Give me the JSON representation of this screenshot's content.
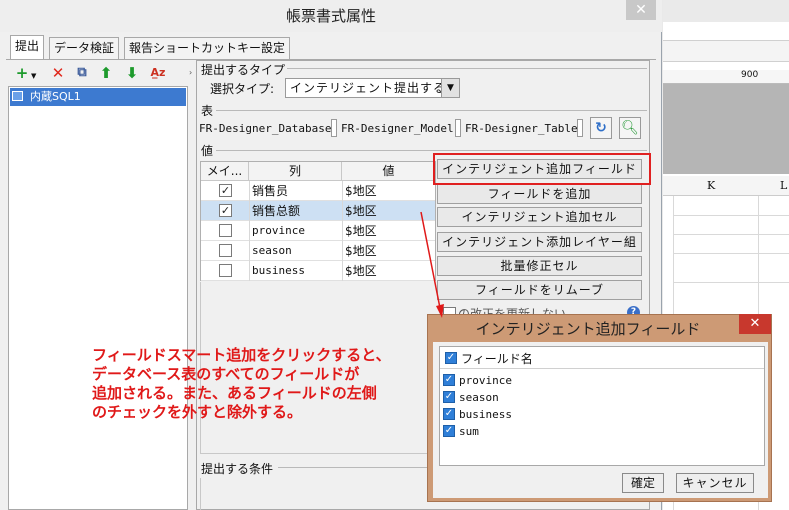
{
  "dialog": {
    "title": "帳票書式属性",
    "close_label": "✕",
    "tabs": [
      "提出",
      "データ検証",
      "報告ショートカットキー設定"
    ]
  },
  "left_panel": {
    "toolbar": [
      "+",
      "✕",
      "⧉",
      "⬆",
      "⬇",
      "A̲z"
    ],
    "datasources": [
      "内蔵SQL1"
    ]
  },
  "submit_type": {
    "section_label": "提出するタイプ",
    "select_label": "選択タイプ:",
    "select_value": "インテリジェント提出する"
  },
  "table_section": {
    "label": "表",
    "database_label": "FR-Designer_Database:",
    "model_label": "FR-Designer_Model:",
    "table_label": "FR-Designer_Table:"
  },
  "values_section": {
    "label": "値",
    "columns": [
      "メイ...",
      "列",
      "値"
    ],
    "rows": [
      {
        "checked": true,
        "column": "销售员",
        "value": "$地区"
      },
      {
        "checked": true,
        "column": "销售总额",
        "value": "$地区"
      },
      {
        "checked": false,
        "column": "province",
        "value": "$地区"
      },
      {
        "checked": false,
        "column": "season",
        "value": "$地区"
      },
      {
        "checked": false,
        "column": "business",
        "value": "$地区"
      }
    ],
    "selected_row": 1,
    "buttons": [
      "インテリジェント追加フィールド",
      "フィールドを追加",
      "インテリジェント追加セル",
      "インテリジェント添加レイヤー組",
      "批量修正セル",
      "フィールドをリムーブ"
    ],
    "partial_checkbox_text": "の改正を更新しない"
  },
  "conditions_section": {
    "label": "提出する条件"
  },
  "annotation": {
    "lines": [
      "フィールドスマート追加をクリックすると、",
      "データベース表のすべてのフィールドが",
      "追加される。また、あるフィールドの左側",
      "のチェックを外すと除外する。"
    ]
  },
  "sheet": {
    "ruler_label": "900",
    "col_k": "K",
    "col_l": "L"
  },
  "popup": {
    "title": "インテリジェント追加フィールド",
    "close_label": "✕",
    "header": "フィールド名",
    "fields": [
      "province",
      "season",
      "business",
      "sum"
    ],
    "ok_label": "確定",
    "cancel_label": "キャンセル"
  },
  "colors": {
    "accent": "#3d7ad0",
    "annotation": "#e01919",
    "popup_frame": "#cd9a75",
    "highlight_box": "#e02020"
  }
}
